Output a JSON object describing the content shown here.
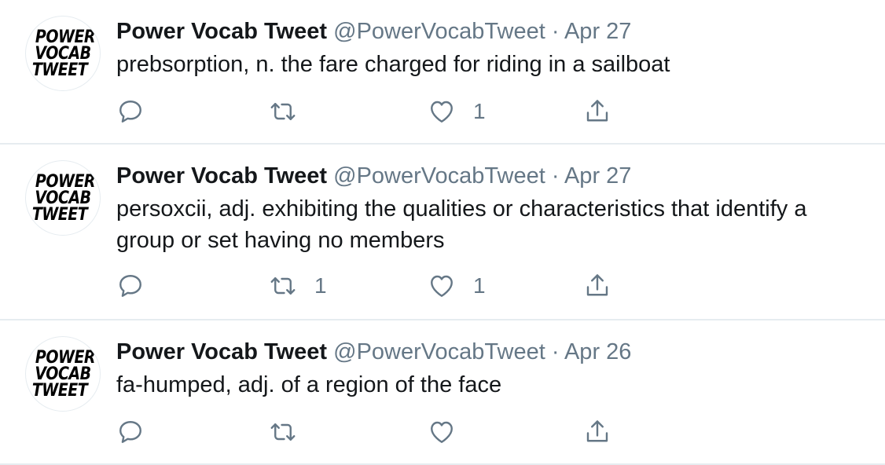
{
  "tweets": [
    {
      "name": "Power Vocab Tweet",
      "handle": "@PowerVocabTweet",
      "separator": "·",
      "date": "Apr 27",
      "text": "prebsorption, n. the fare charged for riding in a sailboat",
      "retweets": "",
      "likes": "1"
    },
    {
      "name": "Power Vocab Tweet",
      "handle": "@PowerVocabTweet",
      "separator": "·",
      "date": "Apr 27",
      "text": "persoxcii, adj. exhibiting the qualities or characteristics that identify a group or set having no members",
      "retweets": "1",
      "likes": "1"
    },
    {
      "name": "Power Vocab Tweet",
      "handle": "@PowerVocabTweet",
      "separator": "·",
      "date": "Apr 26",
      "text": "fa-humped, adj. of a region of the face",
      "retweets": "",
      "likes": ""
    }
  ],
  "avatar_logo": {
    "line1": "POWER",
    "line2": "VOCAB",
    "line3": "TWEET"
  },
  "icons": {
    "reply": "reply-icon",
    "retweet": "retweet-icon",
    "like": "heart-icon",
    "share": "share-icon"
  },
  "colors": {
    "text": "#14171a",
    "secondary": "#657786",
    "divider": "#e6ecf0"
  }
}
